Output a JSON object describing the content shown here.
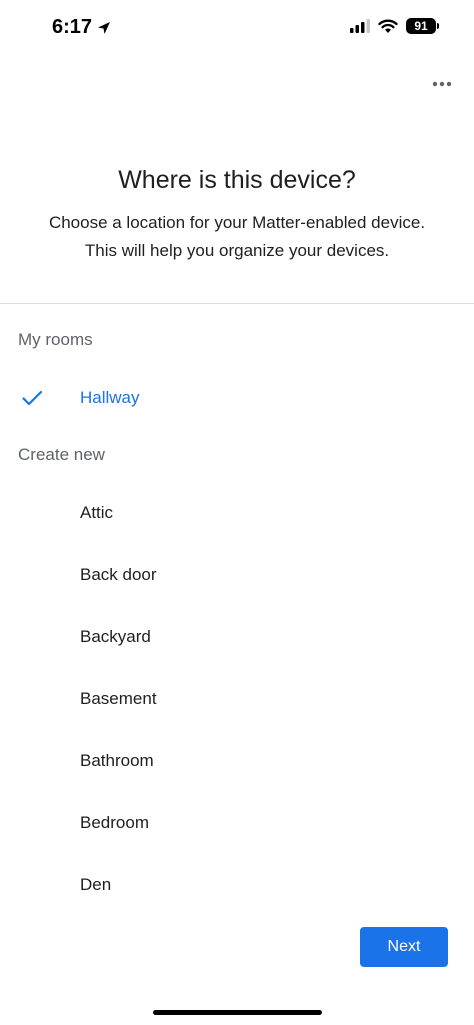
{
  "status_bar": {
    "time": "6:17",
    "battery": "91"
  },
  "header": {
    "title": "Where is this device?",
    "subtitle_line1": "Choose a location for your Matter-enabled device.",
    "subtitle_line2": "This will help you organize your devices."
  },
  "my_rooms": {
    "label": "My rooms",
    "items": [
      {
        "label": "Hallway",
        "selected": true
      }
    ]
  },
  "create_new": {
    "label": "Create new",
    "items": [
      {
        "label": "Attic"
      },
      {
        "label": "Back door"
      },
      {
        "label": "Backyard"
      },
      {
        "label": "Basement"
      },
      {
        "label": "Bathroom"
      },
      {
        "label": "Bedroom"
      },
      {
        "label": "Den"
      }
    ]
  },
  "actions": {
    "next_label": "Next"
  },
  "colors": {
    "accent": "#1a73e8",
    "section_label": "#5f6368",
    "text": "#1f1f1f"
  }
}
